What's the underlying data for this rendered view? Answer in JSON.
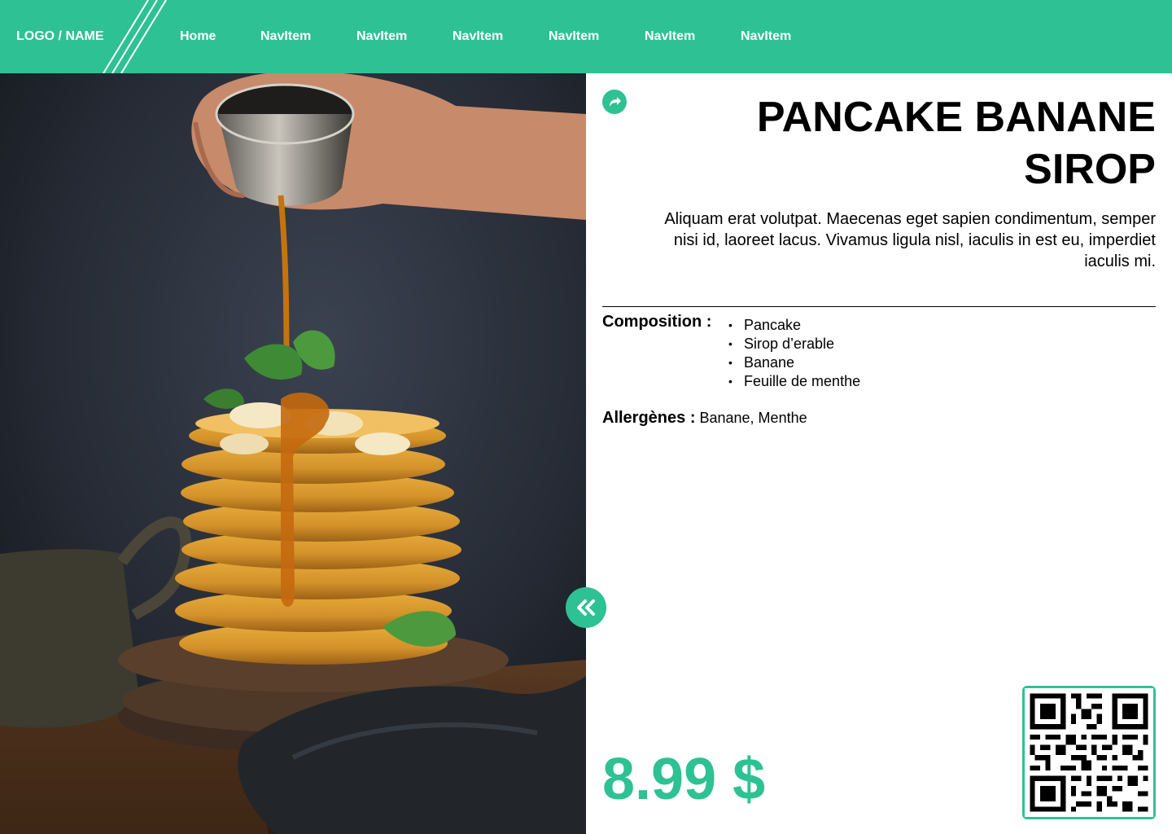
{
  "nav": {
    "logo": "LOGO / NAME",
    "items": [
      "Home",
      "NavItem",
      "NavItem",
      "NavItem",
      "NavItem",
      "NavItem",
      "NavItem"
    ]
  },
  "hero": {
    "icon": "pancake-photo"
  },
  "product": {
    "title": "PANCAKE BANANE SIROP",
    "description": "Aliquam erat volutpat. Maecenas eget sapien condimentum, semper nisi id, laoreet lacus. Vivamus ligula nisl, iaculis in est eu, imperdiet iaculis mi.",
    "composition_label": "Composition :",
    "composition": [
      "Pancake",
      "Sirop d’erable",
      "Banane",
      "Feuille de menthe"
    ],
    "allergens_label": "Allergènes :",
    "allergens": "Banane, Menthe",
    "price": "8.99 $"
  },
  "icons": {
    "share": "share-icon",
    "collapse": "double-chevron-left-icon",
    "qr": "qr-code-icon"
  },
  "colors": {
    "accent": "#2ec193",
    "text": "#000000",
    "background": "#ffffff"
  }
}
